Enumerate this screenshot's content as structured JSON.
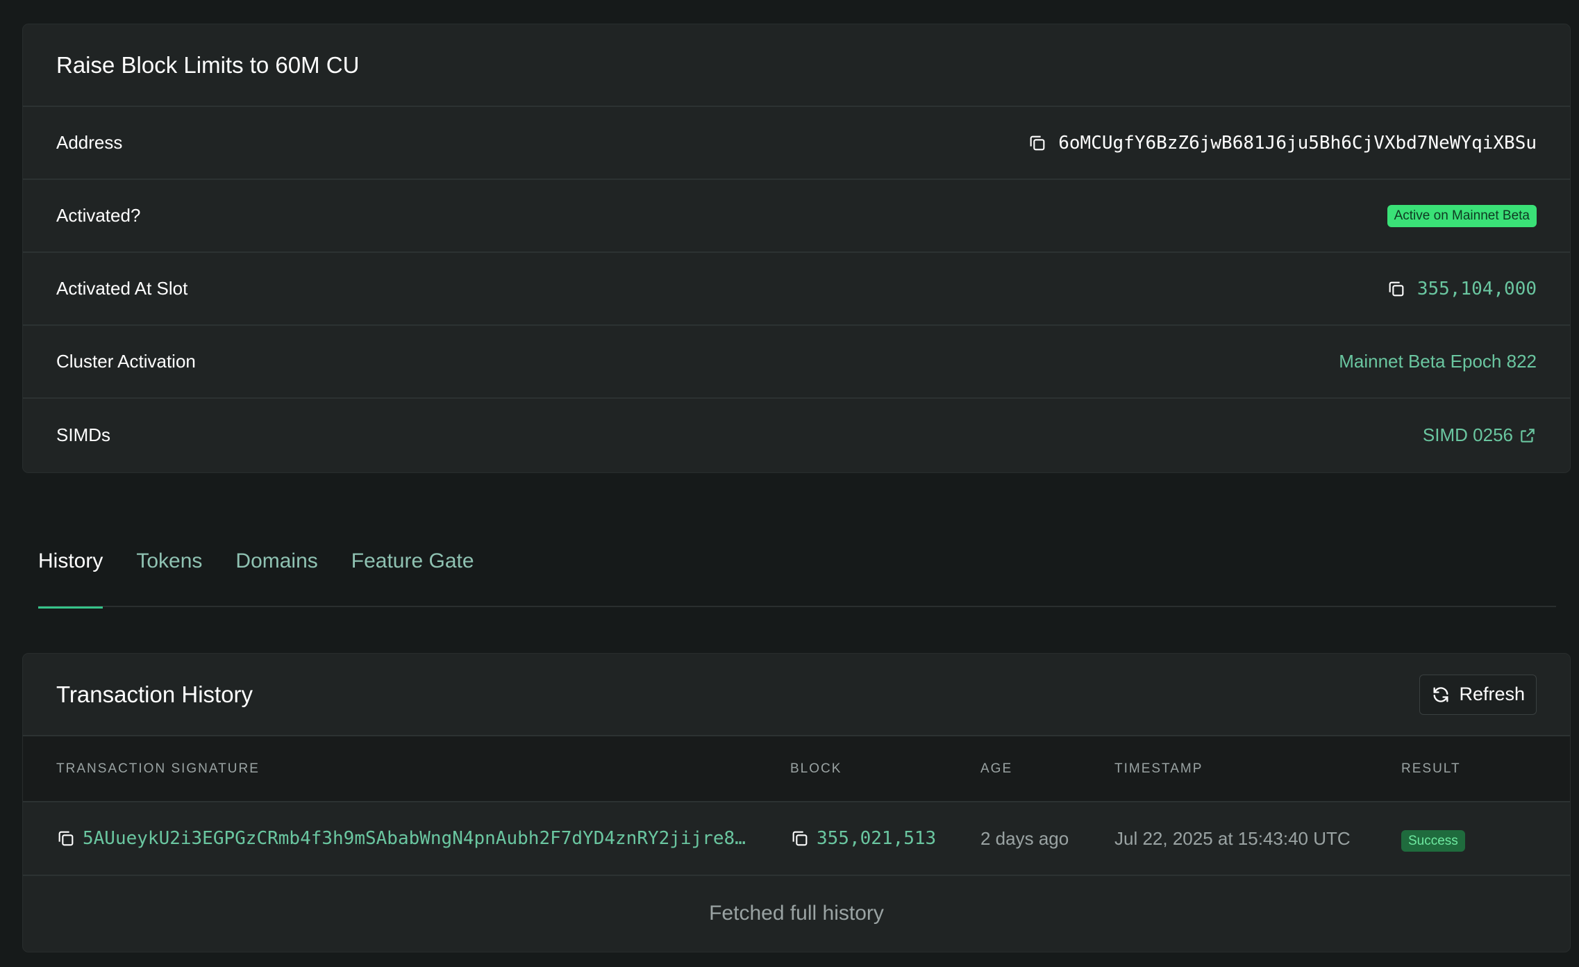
{
  "feature": {
    "title": "Raise Block Limits to 60M CU",
    "rows": {
      "address_label": "Address",
      "address_value": "6oMCUgfY6BzZ6jwB681J6ju5Bh6CjVXbd7NeWYqiXBSu",
      "activated_label": "Activated?",
      "activated_badge": "Active on Mainnet Beta",
      "slot_label": "Activated At Slot",
      "slot_value": "355,104,000",
      "cluster_label": "Cluster Activation",
      "cluster_value": "Mainnet Beta Epoch 822",
      "simds_label": "SIMDs",
      "simds_value": "SIMD 0256"
    }
  },
  "tabs": [
    {
      "label": "History",
      "active": true
    },
    {
      "label": "Tokens",
      "active": false
    },
    {
      "label": "Domains",
      "active": false
    },
    {
      "label": "Feature Gate",
      "active": false
    }
  ],
  "history": {
    "title": "Transaction History",
    "refresh_label": "Refresh",
    "columns": [
      "TRANSACTION SIGNATURE",
      "BLOCK",
      "AGE",
      "TIMESTAMP",
      "RESULT"
    ],
    "rows": [
      {
        "signature": "5AUueykU2i3EGPGzCRmb4f3h9mSAbabWngN4pnAubh2F7dYD4znRY2jijre8…",
        "block": "355,021,513",
        "age": "2 days ago",
        "timestamp": "Jul 22, 2025 at 15:43:40 UTC",
        "result": "Success"
      }
    ],
    "footer": "Fetched full history"
  },
  "icons": {
    "copy": "copy-icon",
    "external": "external-link-icon",
    "refresh": "refresh-icon"
  },
  "colors": {
    "accent_green": "#6ac6a0",
    "active_badge": "#3ae177",
    "success_badge": "#1f6b3d",
    "tab_underline": "#36c48a"
  }
}
